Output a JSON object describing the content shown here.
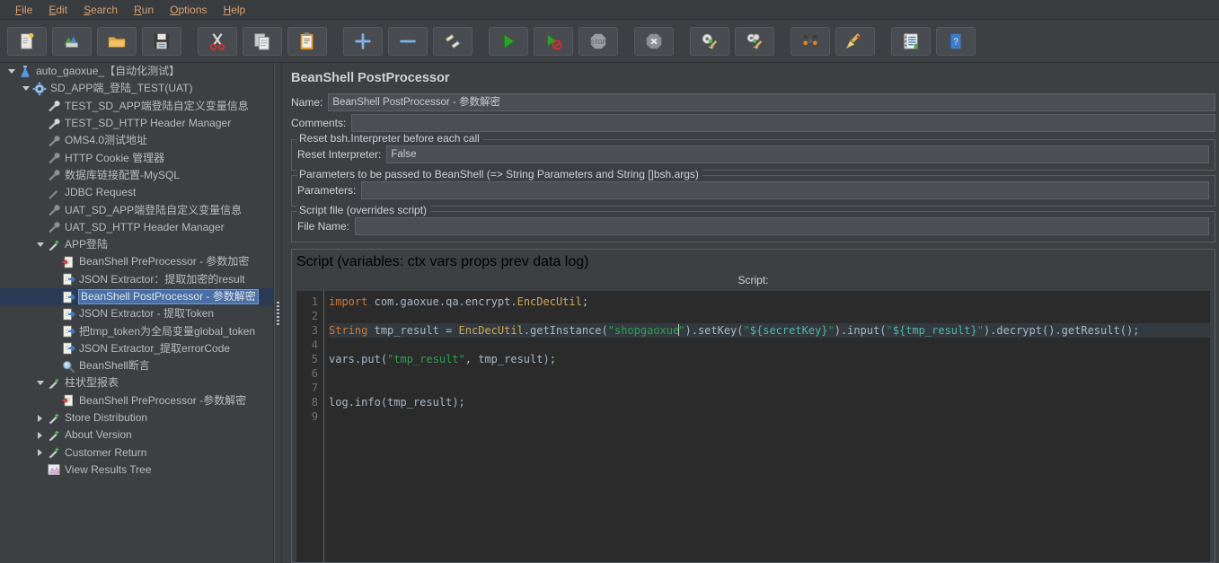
{
  "menu": {
    "items": [
      {
        "label": "File",
        "mnemonic": "F"
      },
      {
        "label": "Edit",
        "mnemonic": "E"
      },
      {
        "label": "Search",
        "mnemonic": "S"
      },
      {
        "label": "Run",
        "mnemonic": "R"
      },
      {
        "label": "Options",
        "mnemonic": "O"
      },
      {
        "label": "Help",
        "mnemonic": "H"
      }
    ]
  },
  "toolbar": {
    "buttons": [
      {
        "name": "new-test-plan-button",
        "icon": "new-document-icon"
      },
      {
        "name": "templates-button",
        "icon": "templates-books-icon"
      },
      {
        "name": "open-button",
        "icon": "open-folder-icon"
      },
      {
        "name": "save-button",
        "icon": "save-floppy-icon"
      },
      {
        "name": "cut-button",
        "icon": "scissors-icon"
      },
      {
        "name": "copy-button",
        "icon": "copy-pages-icon"
      },
      {
        "name": "paste-button",
        "icon": "clipboard-paste-icon"
      },
      {
        "name": "expand-all-button",
        "icon": "plus-icon"
      },
      {
        "name": "collapse-all-button",
        "icon": "minus-icon"
      },
      {
        "name": "toggle-button",
        "icon": "toggle-pencils-icon"
      },
      {
        "name": "start-button",
        "icon": "play-green-icon"
      },
      {
        "name": "start-no-timers-button",
        "icon": "play-no-timers-icon"
      },
      {
        "name": "stop-button",
        "icon": "stop-sign-icon"
      },
      {
        "name": "shutdown-button",
        "icon": "shutdown-x-icon"
      },
      {
        "name": "clear-button",
        "icon": "gear-broom-icon"
      },
      {
        "name": "clear-all-button",
        "icon": "gears-broom-icon"
      },
      {
        "name": "search-button",
        "icon": "binoculars-icon"
      },
      {
        "name": "reset-search-button",
        "icon": "broom-icon"
      },
      {
        "name": "function-helper-button",
        "icon": "notebook-list-icon"
      },
      {
        "name": "help-button",
        "icon": "help-book-icon"
      }
    ]
  },
  "tree": {
    "nodes": [
      {
        "label": "auto_gaoxue_【自动化测试】",
        "indent": 0,
        "toggle": "down",
        "icon": "test-plan-icon",
        "selected": false
      },
      {
        "label": "SD_APP端_登陆_TEST(UAT)",
        "indent": 1,
        "toggle": "down",
        "icon": "thread-group-icon",
        "selected": false
      },
      {
        "label": "TEST_SD_APP端登陆自定义变量信息",
        "indent": 2,
        "toggle": "none",
        "icon": "config-wrench-icon",
        "selected": false
      },
      {
        "label": "TEST_SD_HTTP Header Manager",
        "indent": 2,
        "toggle": "none",
        "icon": "config-wrench-icon",
        "selected": false
      },
      {
        "label": "OMS4.0测试地址",
        "indent": 2,
        "toggle": "none",
        "icon": "config-disabled-icon",
        "selected": false
      },
      {
        "label": "HTTP Cookie 管理器",
        "indent": 2,
        "toggle": "none",
        "icon": "config-disabled-icon",
        "selected": false
      },
      {
        "label": "数据库链接配置-MySQL",
        "indent": 2,
        "toggle": "none",
        "icon": "config-disabled-icon",
        "selected": false
      },
      {
        "label": "JDBC Request",
        "indent": 2,
        "toggle": "none",
        "icon": "sampler-disabled-icon",
        "selected": false
      },
      {
        "label": "UAT_SD_APP端登陆自定义变量信息",
        "indent": 2,
        "toggle": "none",
        "icon": "config-disabled-icon",
        "selected": false
      },
      {
        "label": "UAT_SD_HTTP Header Manager",
        "indent": 2,
        "toggle": "none",
        "icon": "config-disabled-icon",
        "selected": false
      },
      {
        "label": "APP登陆",
        "indent": 2,
        "toggle": "down",
        "icon": "sampler-icon",
        "selected": false
      },
      {
        "label": "BeanShell PreProcessor - 参数加密",
        "indent": 3,
        "toggle": "none",
        "icon": "preprocessor-icon",
        "selected": false
      },
      {
        "label": "JSON Extractor：提取加密的result",
        "indent": 3,
        "toggle": "none",
        "icon": "postprocessor-icon",
        "selected": false
      },
      {
        "label": "BeanShell PostProcessor - 参数解密",
        "indent": 3,
        "toggle": "none",
        "icon": "postprocessor-icon",
        "selected": true
      },
      {
        "label": "JSON Extractor - 提取Token",
        "indent": 3,
        "toggle": "none",
        "icon": "postprocessor-icon",
        "selected": false
      },
      {
        "label": "把tmp_token为全局变量global_token",
        "indent": 3,
        "toggle": "none",
        "icon": "postprocessor-icon",
        "selected": false
      },
      {
        "label": "JSON Extractor_提取errorCode",
        "indent": 3,
        "toggle": "none",
        "icon": "postprocessor-icon",
        "selected": false
      },
      {
        "label": "BeanShell断言",
        "indent": 3,
        "toggle": "none",
        "icon": "assertion-icon",
        "selected": false
      },
      {
        "label": "柱状型报表",
        "indent": 2,
        "toggle": "down",
        "icon": "sampler-icon",
        "selected": false
      },
      {
        "label": "BeanShell PreProcessor -参数解密",
        "indent": 3,
        "toggle": "none",
        "icon": "preprocessor-icon",
        "selected": false
      },
      {
        "label": "Store Distribution",
        "indent": 2,
        "toggle": "right",
        "icon": "sampler-icon",
        "selected": false
      },
      {
        "label": "About Version",
        "indent": 2,
        "toggle": "right",
        "icon": "sampler-icon",
        "selected": false
      },
      {
        "label": "Customer Return",
        "indent": 2,
        "toggle": "right",
        "icon": "sampler-icon",
        "selected": false
      },
      {
        "label": "View Results Tree",
        "indent": 2,
        "toggle": "none",
        "icon": "results-tree-icon",
        "selected": false
      }
    ]
  },
  "panel": {
    "title": "BeanShell PostProcessor",
    "name_label": "Name:",
    "name_value": "BeanShell PostProcessor - 参数解密",
    "comments_label": "Comments:",
    "comments_value": "",
    "reset_group_title": "Reset bsh.Interpreter before each call",
    "reset_label": "Reset Interpreter:",
    "reset_value": "False",
    "params_group_title": "Parameters to be passed to BeanShell (=> String Parameters and String []bsh.args)",
    "params_label": "Parameters:",
    "params_value": "",
    "file_group_title": "Script file (overrides script)",
    "file_label": "File Name:",
    "file_value": "",
    "script_group_title": "Script (variables: ctx vars props prev data log)",
    "script_caption": "Script:"
  },
  "script": {
    "line_numbers": [
      "1",
      "2",
      "3",
      "4",
      "5",
      "6",
      "7",
      "8",
      "9"
    ],
    "lines": [
      "import com.gaoxue.qa.encrypt.EncDecUtil;",
      "",
      "String tmp_result = EncDecUtil.getInstance(\"shopgaoxue\").setKey(\"${secretKey}\").input(\"${tmp_result}\").decrypt().getResult();",
      "",
      "vars.put(\"tmp_result\", tmp_result);",
      "",
      "",
      "log.info(tmp_result);",
      ""
    ],
    "caret_line": 3
  },
  "colors": {
    "window_bg": "#3c4043",
    "menu_text": "#d8a070",
    "editor_bg": "#2b2b2b",
    "selection_row": "#2b3a54",
    "selection_text_bg": "#4a6fa5",
    "keyword": "#cc7832",
    "string": "#2e9e4f",
    "variable": "#52b5a0",
    "class_name": "#cfa857",
    "plain_code": "#a9b7c6"
  }
}
